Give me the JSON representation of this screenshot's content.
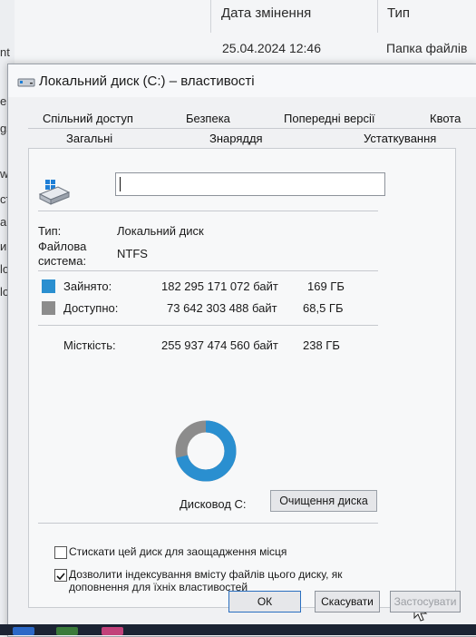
{
  "explorer": {
    "col_date_header": "Дата змінення",
    "col_type_header": "Тип",
    "row_date": "25.04.2024 12:46",
    "row_type": "Папка файлів",
    "left_fragments": [
      "nt",
      "er",
      "gs",
      "wi",
      "сту",
      "а пі",
      "и пі",
      "loa",
      "loa"
    ]
  },
  "dialog": {
    "title": "Локальний диск (C:) – властивості",
    "tabs_row1": [
      "Спільний доступ",
      "Безпека",
      "Попередні версії",
      "Квота"
    ],
    "tabs_row2": [
      "Загальні",
      "Знаряддя",
      "Устаткування"
    ],
    "active_tab": "Загальні",
    "name_value": "",
    "type_label": "Тип:",
    "type_value": "Локальний диск",
    "fs_label": "Файлова система:",
    "fs_value": "NTFS",
    "used_label": "Зайнято:",
    "used_bytes": "182 295 171 072 байт",
    "used_gb": "169 ГБ",
    "free_label": "Доступно:",
    "free_bytes": "73 642 303 488 байт",
    "free_gb": "68,5 ГБ",
    "capacity_label": "Місткість:",
    "capacity_bytes": "255 937 474 560 байт",
    "capacity_gb": "238 ГБ",
    "used_fraction": 0.712,
    "drive_label": "Дисковод C:",
    "cleanup_button": "Очищення диска",
    "compress_label": "Стискати цей диск для заощадження місця",
    "compress_checked": false,
    "index_label_1": "Дозволити індексування вмісту файлів цього диску, як",
    "index_label_2": "доповнення для їхніх властивостей",
    "index_checked": true,
    "ok_button": "ОК",
    "cancel_button": "Скасувати",
    "apply_button": "Застосувати"
  },
  "colors": {
    "used": "#2a8fd0",
    "free": "#8c8c8c"
  }
}
